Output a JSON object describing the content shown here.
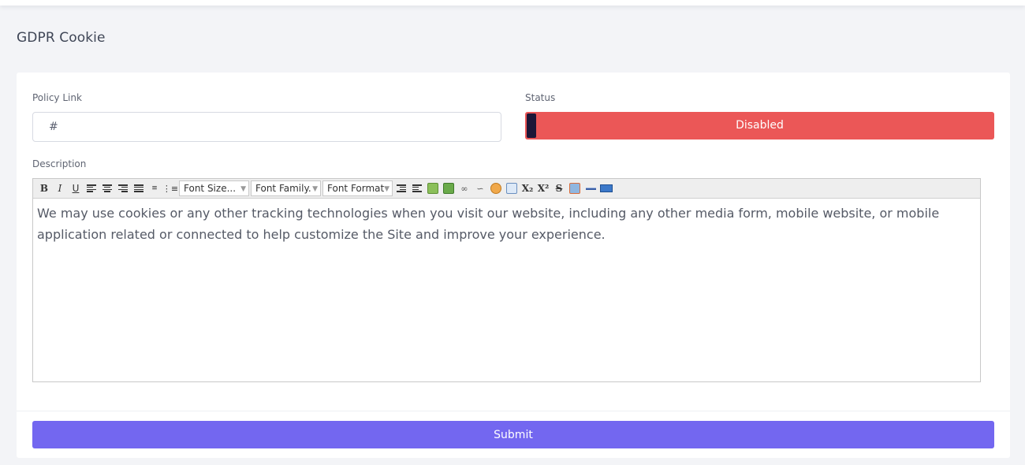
{
  "page": {
    "title": "GDPR Cookie"
  },
  "form": {
    "policy_link": {
      "label": "Policy Link",
      "value": "#"
    },
    "status": {
      "label": "Status",
      "value": "Disabled",
      "color": "#eb5757"
    },
    "description": {
      "label": "Description",
      "content": "We may use cookies or any other tracking technologies when you visit our website, including any other media form, mobile website, or mobile application related or connected to help customize the Site and improve your experience."
    },
    "submit_label": "Submit",
    "submit_color": "#7367f0"
  },
  "toolbar": {
    "bold": "B",
    "italic": "I",
    "underline": "U",
    "subscript": "X₂",
    "superscript": "X²",
    "strike": "S",
    "font_size": "Font Size...",
    "font_family": "Font Family.",
    "font_format": "Font Format",
    "icons": [
      "bold-icon",
      "italic-icon",
      "underline-icon",
      "align-left-icon",
      "align-center-icon",
      "align-right-icon",
      "align-justify-icon",
      "ordered-list-icon",
      "unordered-list-icon",
      "outdent-icon",
      "indent-icon",
      "insert-image-icon",
      "upload-image-icon",
      "link-icon",
      "unlink-icon",
      "color-icon",
      "edit-html-icon",
      "subscript-icon",
      "superscript-icon",
      "strikethrough-icon",
      "remove-format-icon",
      "horizontal-rule-icon",
      "keyboard-icon"
    ]
  }
}
